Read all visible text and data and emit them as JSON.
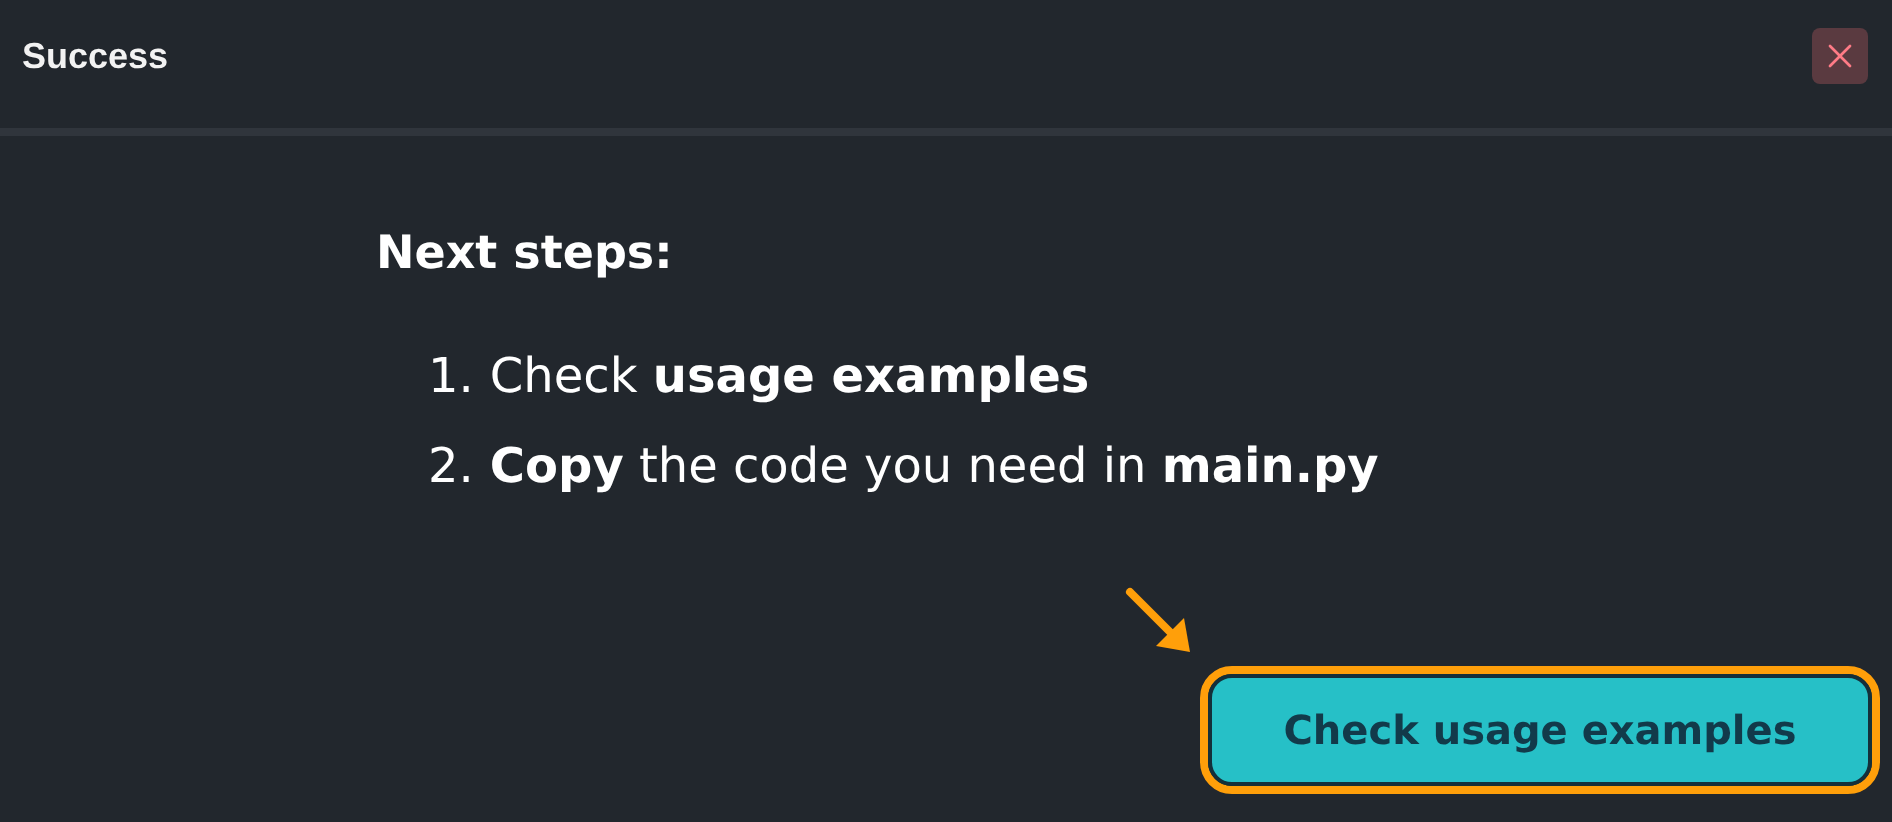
{
  "dialog": {
    "title": "Success"
  },
  "heading": "Next steps:",
  "steps": [
    {
      "number": "1.",
      "text": "Check **usage examples**"
    },
    {
      "number": "2.",
      "text": "**Copy** the code you need in **main.py**"
    }
  ],
  "button": {
    "label": "Check usage examples",
    "highlighted": true
  }
}
